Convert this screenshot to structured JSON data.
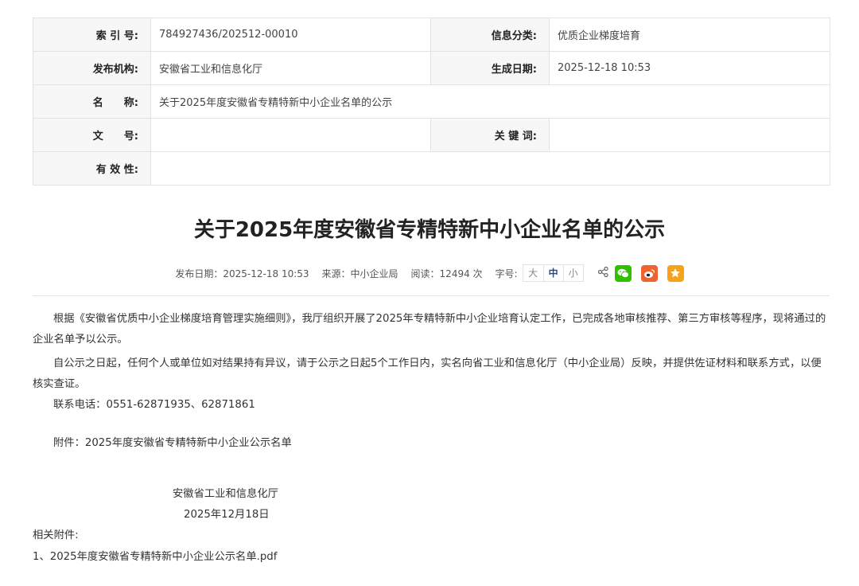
{
  "meta": {
    "index_label": "索 引 号:",
    "index_value": "784927436/202512-00010",
    "category_label": "信息分类:",
    "category_value": "优质企业梯度培育",
    "publisher_label": "发布机构:",
    "publisher_value": "安徽省工业和信息化厅",
    "date_label": "生成日期:",
    "date_value": "2025-12-18 10:53",
    "name_label": "名　　称:",
    "name_value": "关于2025年度安徽省专精特新中小企业名单的公示",
    "docno_label": "文　　号:",
    "docno_value": "",
    "keyword_label": "关 键 词:",
    "keyword_value": "",
    "validity_label": "有 效 性:",
    "validity_value": ""
  },
  "article": {
    "title": "关于2025年度安徽省专精特新中小企业名单的公示",
    "publish_date": "发布日期：2025-12-18 10:53",
    "source": "来源：中小企业局",
    "reads": "阅读：12494 次",
    "font_size_label": "字号:",
    "font_sizes": [
      "大",
      "中",
      "小"
    ],
    "paragraph1": "根据《安徽省优质中小企业梯度培育管理实施细则》，我厅组织开展了2025年专精特新中小企业培育认定工作，已完成各地审核推荐、第三方审核等程序，现将通过的企业名单予以公示。",
    "paragraph2": "自公示之日起，任何个人或单位如对结果持有异议，请于公示之日起5个工作日内，实名向省工业和信息化厅（中小企业局）反映，并提供佐证材料和联系方式，以便核实查证。",
    "phone": "联系电话：0551-62871935、62871861",
    "attachment_note": "附件：2025年度安徽省专精特新中小企业公示名单",
    "sign_org": "安徽省工业和信息化厅",
    "sign_date": "2025年12月18日",
    "related_label": "相关附件:",
    "related_file": "1、2025年度安徽省专精特新中小企业公示名单.pdf"
  },
  "share_icons": [
    "share-icon",
    "wechat-icon",
    "weibo-icon",
    "favorite-icon"
  ],
  "colors": {
    "wechat": "#2dc100",
    "weibo": "#f0622f",
    "favorite": "#f7a21b",
    "active_font": "#1a4aa0"
  }
}
